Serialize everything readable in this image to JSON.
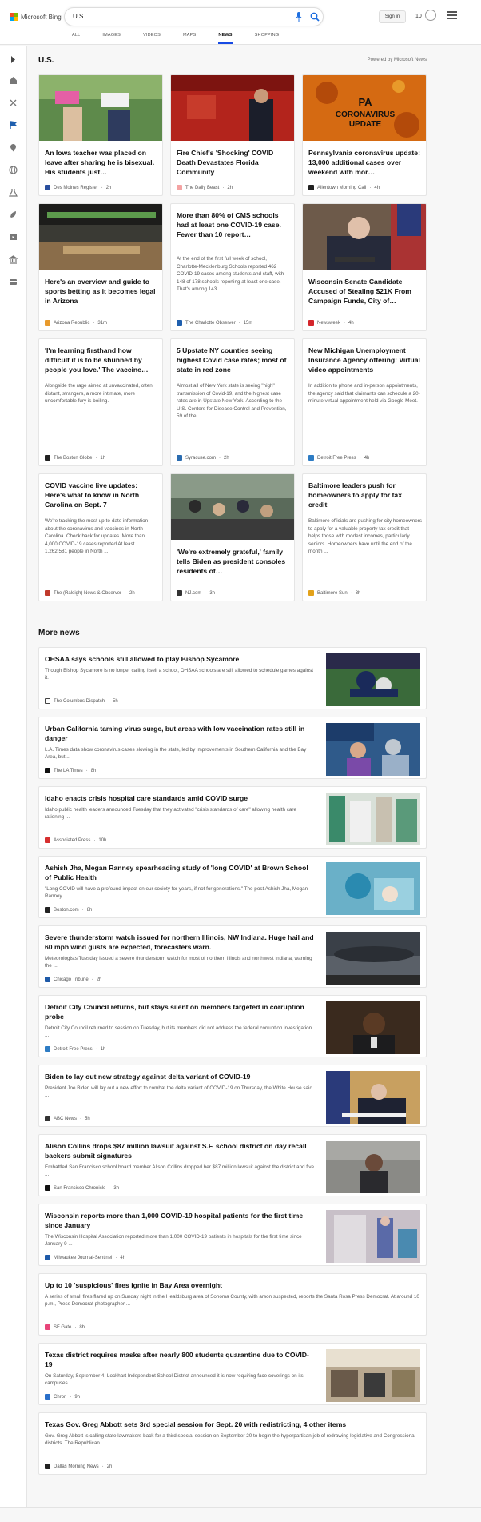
{
  "header": {
    "brand": "Microsoft Bing",
    "search_value": "U.S.",
    "signin_label": "Sign in",
    "rewards_count": "10",
    "tabs": [
      {
        "label": "ALL"
      },
      {
        "label": "IMAGES"
      },
      {
        "label": "VIDEOS"
      },
      {
        "label": "MAPS"
      },
      {
        "label": "NEWS"
      },
      {
        "label": "SHOPPING"
      }
    ],
    "active_tab": "NEWS"
  },
  "sidebar": {
    "icons": [
      "expand-icon",
      "home-icon",
      "recent-icon",
      "flag-icon",
      "location-icon",
      "globe-icon",
      "science-icon",
      "rocket-icon",
      "entertainment-icon",
      "bank-icon",
      "cards-icon"
    ]
  },
  "main": {
    "title": "U.S.",
    "powered_by": "Powered by Microsoft News",
    "cards": [
      {
        "title": "An Iowa teacher was placed on leave after sharing he is bisexual. His students just…",
        "snippet": "",
        "source": "Des Moines Register",
        "time": "2h",
        "logo_color": "#2a4f9e"
      },
      {
        "title": "Fire Chief's 'Shocking' COVID Death Devastates Florida Community",
        "snippet": "",
        "source": "The Daily Beast",
        "time": "2h",
        "logo_color": "#f4a3a3"
      },
      {
        "title": "Pennsylvania coronavirus update: 13,000 additional cases over weekend with mor…",
        "snippet": "",
        "source": "Allentown Morning Call",
        "time": "4h",
        "logo_color": "#222222"
      },
      {
        "title": "Here's an overview and guide to sports betting as it becomes legal in Arizona",
        "snippet": "",
        "source": "Arizona Republic",
        "time": "31m",
        "logo_color": "#e89a2c"
      },
      {
        "title": "More than 80% of CMS schools had at least one COVID-19 case. Fewer than 10 report…",
        "snippet": "At the end of the first full week of school, Charlotte-Mecklenburg Schools reported 462 COVID-19 cases among students and staff, with 148 of 178 schools reporting at least one case. That's among 143 ...",
        "source": "The Charlotte Observer",
        "time": "15m",
        "logo_color": "#1f5fae"
      },
      {
        "title": "Wisconsin Senate Candidate Accused of Stealing $21K From Campaign Funds, City of…",
        "snippet": "",
        "source": "Newsweek",
        "time": "4h",
        "logo_color": "#d4252b"
      },
      {
        "title": "'I'm learning firsthand how difficult it is to be shunned by people you love.' The vaccine…",
        "snippet": "Alongside the rage aimed at unvaccinated, often distant, strangers, a more intimate, more uncomfortable fury is boiling.",
        "source": "The Boston Globe",
        "time": "1h",
        "logo_color": "#222222"
      },
      {
        "title": "5 Upstate NY counties seeing highest Covid case rates; most of state in red zone",
        "snippet": "Almost all of New York state is seeing \"high\" transmission of Covid-19, and the highest case rates are in Upstate New York. According to the U.S. Centers for Disease Control and Prevention, 59 of the ...",
        "source": "Syracuse.com",
        "time": "2h",
        "logo_color": "#2b6cb0"
      },
      {
        "title": "New Michigan Unemployment Insurance Agency offering: Virtual video appointments",
        "snippet": "In addition to phone and in-person appointments, the agency said that claimants can schedule a 20-minute virtual appointment held via Google Meet.",
        "source": "Detroit Free Press",
        "time": "4h",
        "logo_color": "#2e7cc4"
      },
      {
        "title": "COVID vaccine live updates: Here's what to know in North Carolina on Sept. 7",
        "snippet": "We're tracking the most up-to-date information about the coronavirus and vaccines in North Carolina. Check back for updates. More than 4,000 COVID-19 cases reported At least 1,262,581 people in North ...",
        "source": "The (Raleigh) News & Observer",
        "time": "2h",
        "logo_color": "#c0392b"
      },
      {
        "title": "'We're extremely grateful,' family tells Biden as president consoles residents of…",
        "snippet": "",
        "source": "NJ.com",
        "time": "3h",
        "logo_color": "#333333"
      },
      {
        "title": "Baltimore leaders push for homeowners to apply for tax credit",
        "snippet": "Baltimore officials are pushing for city homeowners to apply for a valuable property tax credit that helps those with modest incomes, particularly seniors. Homeowners have until the end of the month ...",
        "source": "Baltimore Sun",
        "time": "3h",
        "logo_color": "#e3a21a"
      }
    ],
    "more_news_title": "More news",
    "more_news": [
      {
        "title": "OHSAA says schools still allowed to play Bishop Sycamore",
        "snippet": "Though Bishop Sycamore is no longer calling itself a school, OHSAA schools are still allowed to schedule games against it.",
        "source": "The Columbus Dispatch",
        "time": "5h",
        "logo_color": "#444444"
      },
      {
        "title": "Urban California taming virus surge, but areas with low vaccination rates still in danger",
        "snippet": "L.A. Times data show coronavirus cases slowing in the state, led by improvements in Southern California and the Bay Area, but ...",
        "source": "The LA Times",
        "time": "8h",
        "logo_color": "#111111"
      },
      {
        "title": "Idaho enacts crisis hospital care standards amid COVID surge",
        "snippet": "Idaho public health leaders announced Tuesday that they activated \"crisis standards of care\" allowing health care rationing ...",
        "source": "Associated Press",
        "time": "10h",
        "logo_color": "#d62f2f"
      },
      {
        "title": "Ashish Jha, Megan Ranney spearheading study of 'long COVID' at Brown School of Public Health",
        "snippet": "\"Long COVID will have a profound impact on our society for years, if not for generations.\" The post Ashish Jha, Megan Ranney ...",
        "source": "Boston.com",
        "time": "8h",
        "logo_color": "#222222"
      },
      {
        "title": "Severe thunderstorm watch issued for northern Illinois, NW Indiana. Huge hail and 60 mph wind gusts are expected, forecasters warn.",
        "snippet": "Meteorologists Tuesday issued a severe thunderstorm watch for most of northern Illinois and northwest Indiana, warning the ...",
        "source": "Chicago Tribune",
        "time": "2h",
        "logo_color": "#1e5aa8"
      },
      {
        "title": "Detroit City Council returns, but stays silent on members targeted in corruption probe",
        "snippet": "Detroit City Council returned to session on Tuesday, but its members did not address the federal corruption investigation ...",
        "source": "Detroit Free Press",
        "time": "1h",
        "logo_color": "#2e7cc4"
      },
      {
        "title": "Biden to lay out new strategy against delta variant of COVID-19",
        "snippet": "President Joe Biden will lay out a new effort to combat the delta variant of COVID-19 on Thursday, the White House said ...",
        "source": "ABC News",
        "time": "5h",
        "logo_color": "#333333"
      },
      {
        "title": "Alison Collins drops $87 million lawsuit against S.F. school district on day recall backers submit signatures",
        "snippet": "Embattled San Francisco school board member Alison Collins dropped her $87 million lawsuit against the district and five ...",
        "source": "San Francisco Chronicle",
        "time": "3h",
        "logo_color": "#111111"
      },
      {
        "title": "Wisconsin reports more than 1,000 COVID-19 hospital patients for the first time since January",
        "snippet": "The Wisconsin Hospital Association reported more than 1,000 COVID-19 patients in hospitals for the first time since January 9 ...",
        "source": "Milwaukee Journal-Sentinel",
        "time": "4h",
        "logo_color": "#1e5aa8"
      },
      {
        "title": "Up to 10 'suspicious' fires ignite in Bay Area overnight",
        "snippet": "A series of small fires flared up on Sunday night in the Healdsburg area of Sonoma County, with arson suspected, reports the Santa Rosa Press Democrat. At around 10 p.m., Press Democrat photographer ...",
        "source": "SF Gate",
        "time": "8h",
        "logo_color": "#e8457a"
      },
      {
        "title": "Texas district requires masks after nearly 800 students quarantine due to COVID-19",
        "snippet": "On Saturday, September 4, Lockhart Independent School District announced it is now requiring face coverings on its campuses ...",
        "source": "Chron",
        "time": "9h",
        "logo_color": "#2a6fc9"
      },
      {
        "title": "Texas Gov. Greg Abbott sets 3rd special session for Sept. 20 with redistricting, 4 other items",
        "snippet": "Gov. Greg Abbott is calling state lawmakers back for a third special session on September 20 to begin the hyperpartisan job of redrawing legislative and Congressional districts. The Republican ...",
        "source": "Dallas Morning News",
        "time": "2h",
        "logo_color": "#222222"
      }
    ]
  }
}
